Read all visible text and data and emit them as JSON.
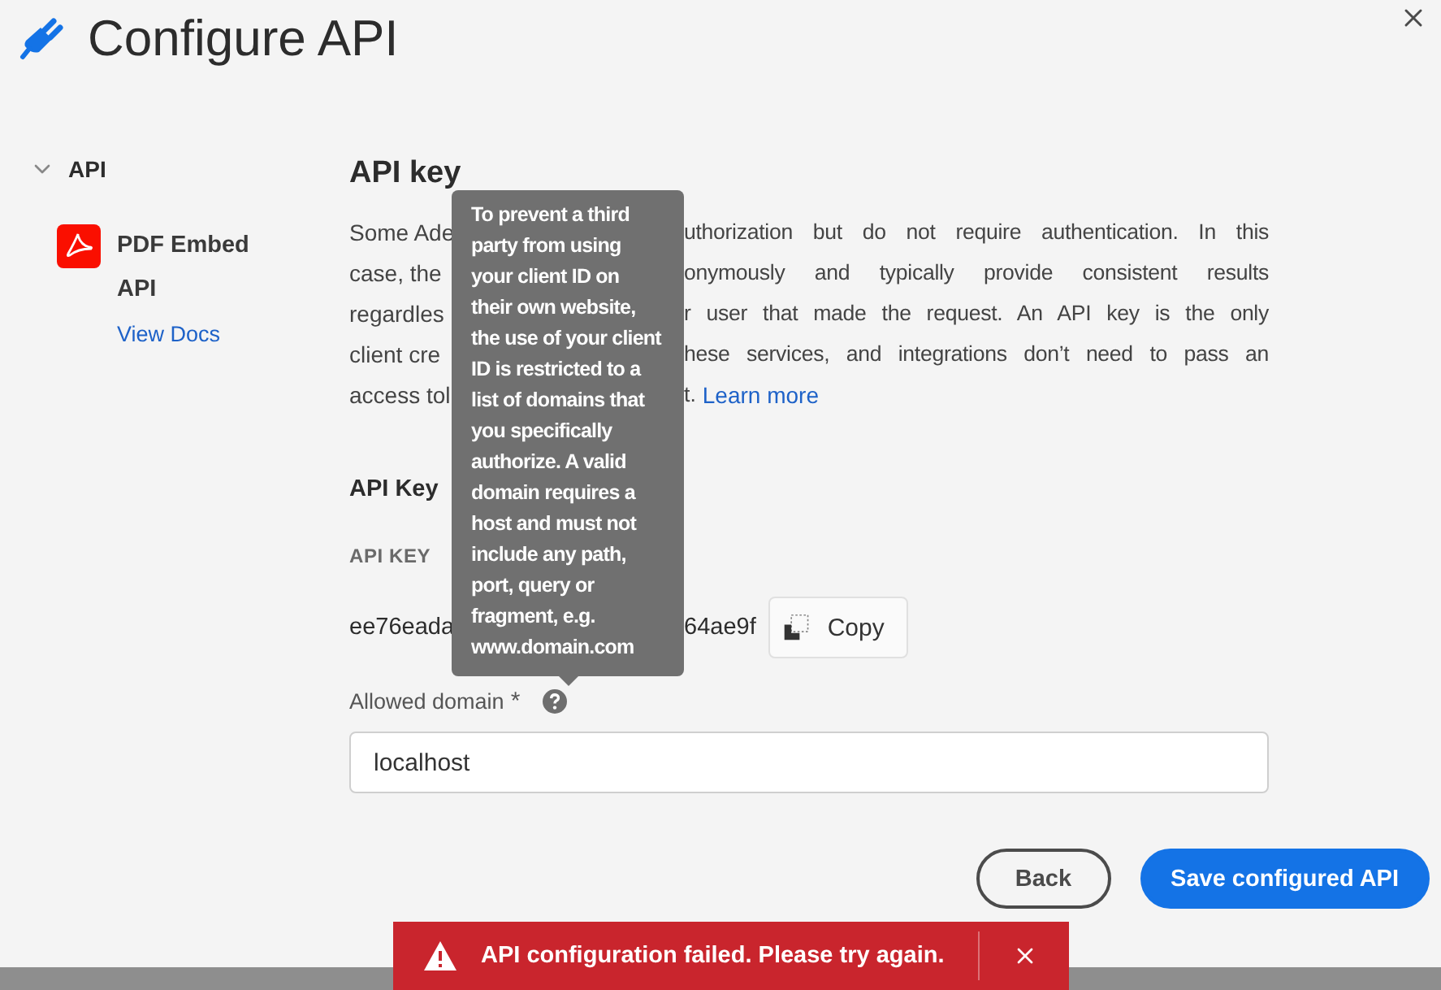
{
  "header": {
    "title": "Configure API"
  },
  "sidebar": {
    "section": {
      "label": "API",
      "expanded": true
    },
    "items": [
      {
        "name": "PDF Embed API",
        "link": "View Docs"
      }
    ]
  },
  "api_key": {
    "heading": "API key",
    "description_lines": [
      {
        "left": "Some Ade",
        "right": "uthorization but do not require authentication. In this"
      },
      {
        "left": "case,  the",
        "right": "onymously and typically provide consistent results"
      },
      {
        "left": "regardles",
        "right": "r user that made the request. An API key is the only"
      },
      {
        "left": "client cre",
        "right": "hese services, and integrations don’t need to pass an"
      },
      {
        "left": "access tol",
        "right": "t.",
        "link": "Learn more"
      }
    ],
    "key_heading": "API Key",
    "key_label": "API KEY",
    "key_value_left": "ee76eada",
    "key_value_right": "64ae9f",
    "copy_button": "Copy",
    "domain": {
      "label": "Allowed domain",
      "required_mark": "*",
      "value": "localhost"
    },
    "tooltip": "To prevent a third party from using your client ID on their own website, the use of your client ID is restricted to a list of domains that you specifically authorize. A valid domain requires a host and must not include any path, port, query or fragment, e.g. www.domain.com"
  },
  "buttons": [
    {
      "label": "Back",
      "kind": "secondary"
    },
    {
      "label": "Save configured API",
      "kind": "primary"
    }
  ],
  "toast": {
    "message": "API configuration failed. Please try again.",
    "kind": "error"
  }
}
